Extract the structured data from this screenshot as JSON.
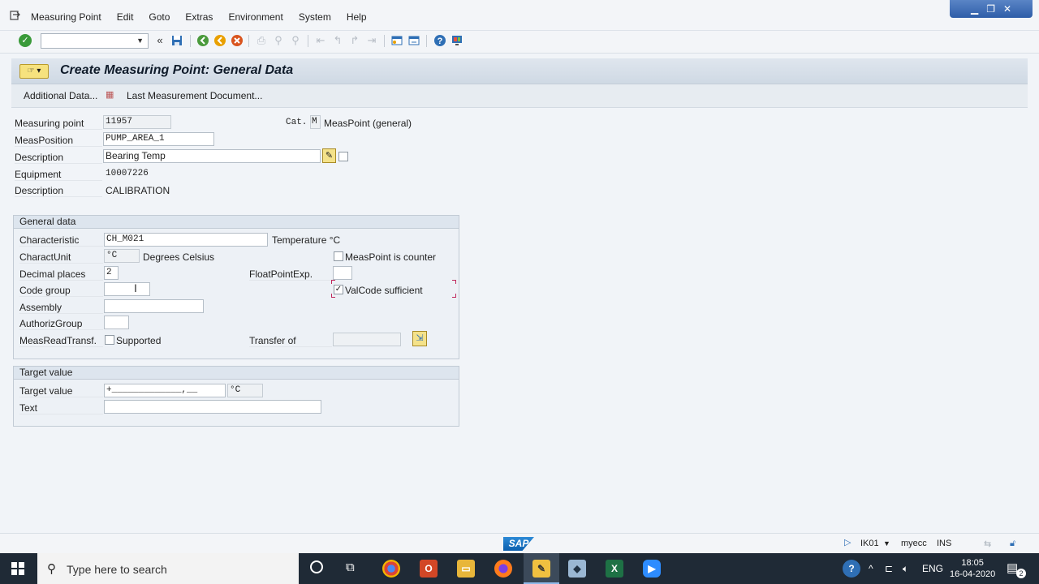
{
  "menu": {
    "items": [
      "Measuring Point",
      "Edit",
      "Goto",
      "Extras",
      "Environment",
      "System",
      "Help"
    ]
  },
  "window_controls": [
    "▁",
    "❐",
    "✕"
  ],
  "toolbar": {
    "command_field_value": "",
    "icons": [
      "enter-icon",
      "back-arrows-icon",
      "save-icon",
      "back-icon",
      "exit-icon",
      "cancel-icon",
      "print-icon",
      "find-icon",
      "find-next-icon",
      "first-page-icon",
      "previous-page-icon",
      "next-page-icon",
      "last-page-icon",
      "create-session-icon",
      "shortcut-icon",
      "help-icon",
      "customize-layout-icon"
    ]
  },
  "title": "Create Measuring Point: General Data",
  "app_toolbar": {
    "additional_data": "Additional Data...",
    "last_measurement_doc": "Last Measurement Document..."
  },
  "header": {
    "measuring_point_label": "Measuring point",
    "measuring_point_value": "11957",
    "cat_label": "Cat.",
    "cat_value": "M",
    "cat_text": "MeasPoint (general)",
    "meas_position_label": "MeasPosition",
    "meas_position_value": "PUMP_AREA_1",
    "description_label": "Description",
    "description_value": "Bearing Temp",
    "equipment_label": "Equipment",
    "equipment_value": "10007226",
    "equip_description_label": "Description",
    "equip_description_value": "CALIBRATION"
  },
  "general_data": {
    "heading": "General data",
    "characteristic_label": "Characteristic",
    "characteristic_value": "CH_M021",
    "characteristic_text": "Temperature °C",
    "charact_unit_label": "CharactUnit",
    "charact_unit_value": "°C",
    "charact_unit_text": "Degrees Celsius",
    "counter_label": "MeasPoint is counter",
    "counter_checked": false,
    "decimal_places_label": "Decimal places",
    "decimal_places_value": "2",
    "float_point_label": "FloatPointExp.",
    "float_point_value": "",
    "code_group_label": "Code group",
    "code_group_value": "",
    "valcode_label": "ValCode sufficient",
    "valcode_checked": true,
    "assembly_label": "Assembly",
    "assembly_value": "",
    "authoriz_group_label": "AuthorizGroup",
    "authoriz_group_value": "",
    "meas_read_transf_label": "MeasReadTransf.",
    "supported_label": "Supported",
    "supported_checked": false,
    "transfer_of_label": "Transfer of",
    "transfer_of_value": ""
  },
  "target_value": {
    "heading": "Target value",
    "target_value_label": "Target value",
    "target_value_value": "+_____________,__",
    "target_unit": "°C",
    "text_label": "Text",
    "text_value": ""
  },
  "statusbar": {
    "logo": "SAP",
    "transaction": "IK01",
    "system": "myecc",
    "mode": "INS"
  },
  "taskbar": {
    "search_placeholder": "Type here to search",
    "language": "ENG",
    "time": "18:05",
    "date": "16-04-2020",
    "notifications": "2"
  }
}
